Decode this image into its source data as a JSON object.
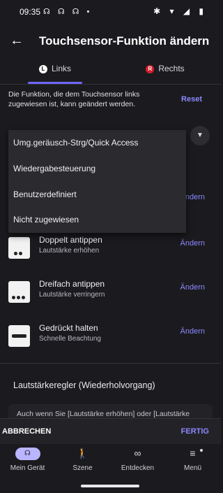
{
  "status_bar": {
    "time": "09:35",
    "left_icons": "☊ ☊ ☊ •",
    "right_icons": "✱ ▾ ◢ ▮"
  },
  "header": {
    "title": "Touchsensor-Funktion ändern",
    "back_icon": "arrow-left"
  },
  "tabs": [
    {
      "badge": "L",
      "label": "Links"
    },
    {
      "badge": "R",
      "label": "Rechts"
    }
  ],
  "description": "Die Funktion, die dem Touchsensor links zugewiesen ist, kann geändert werden.",
  "reset_label": "Reset",
  "dropdown": {
    "options": [
      "Umg.geräusch-Strg/Quick Access",
      "Wiedergabesteuerung",
      "Benutzerdefiniert",
      "Nicht zugewiesen"
    ]
  },
  "hidden_row_change_label": "Ändern",
  "gestures": [
    {
      "title": "Doppelt antippen",
      "subtitle": "Lautstärke erhöhen",
      "action": "Ändern"
    },
    {
      "title": "Dreifach antippen",
      "subtitle": "Lautstärke verringern",
      "action": "Ändern"
    },
    {
      "title": "Gedrückt halten",
      "subtitle": "Schnelle Beachtung",
      "action": "Ändern"
    }
  ],
  "volume_section": {
    "title": "Lautstärkeregler (Wiederholvorgang)",
    "info": "Auch wenn Sie [Lautstärke erhöhen] oder [Lautstärke"
  },
  "actions": {
    "cancel": "ABBRECHEN",
    "done": "FERTIG"
  },
  "bottom_nav": [
    {
      "label": "Mein Gerät",
      "icon": "☊"
    },
    {
      "label": "Szene",
      "icon": "🚶"
    },
    {
      "label": "Entdecken",
      "icon": "∞"
    },
    {
      "label": "Menü",
      "icon": "≡"
    }
  ],
  "colors": {
    "accent": "#8d87ff",
    "background": "#1b1b1f",
    "right_badge": "#d3202b"
  }
}
